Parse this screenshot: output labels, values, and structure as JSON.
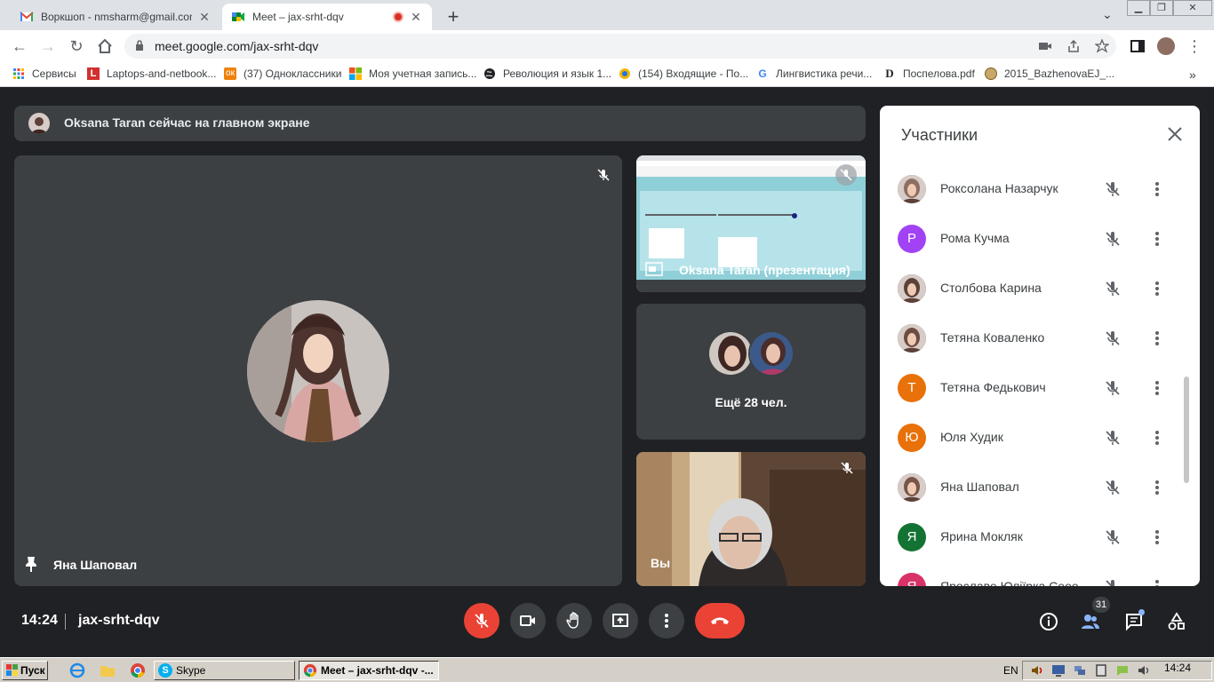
{
  "browser": {
    "tabs": [
      {
        "title": "Воркшоп - nmsharm@gmail.com - G",
        "icon": "gmail-icon"
      },
      {
        "title": "Meet – jax-srht-dqv",
        "icon": "meet-icon",
        "active": true
      }
    ],
    "url": "meet.google.com/jax-srht-dqv",
    "bookmarks": [
      {
        "label": "Сервисы",
        "icon": "apps-grid-icon"
      },
      {
        "label": "Laptops-and-netbook...",
        "icon": "laptops-icon"
      },
      {
        "label": "(37) Одноклассники",
        "icon": "odnoklassniki-icon"
      },
      {
        "label": "Моя учетная запись...",
        "icon": "microsoft-icon"
      },
      {
        "label": "Революция и язык 1...",
        "icon": "globe-icon"
      },
      {
        "label": "(154) Входящие - По...",
        "icon": "mail-icon"
      },
      {
        "label": "Лингвистика речи...",
        "icon": "google-icon"
      },
      {
        "label": "Поспелова.pdf",
        "icon": "pdf-icon"
      },
      {
        "label": "2015_BazhenovaEJ_...",
        "icon": "doc-icon"
      }
    ]
  },
  "meet": {
    "banner": "Oksana Taran сейчас на главном экране",
    "main_name": "Яна Шаповал",
    "presentation_label": "Oksana Taran (презентация)",
    "more_label": "Ещё 28 чел.",
    "self_label": "Вы",
    "time": "14:24",
    "meeting_code": "jax-srht-dqv",
    "participant_count": "31"
  },
  "participants": {
    "title": "Участники",
    "list": [
      {
        "name": "Роксолана Назарчук",
        "avatar": "photo",
        "color": "#8d6e63"
      },
      {
        "name": "Рома Кучма",
        "avatar": "Р",
        "color": "#a142f4"
      },
      {
        "name": "Столбова Карина",
        "avatar": "photo",
        "color": "#5d4037"
      },
      {
        "name": "Тетяна Коваленко",
        "avatar": "photo",
        "color": "#6d4c41"
      },
      {
        "name": "Тетяна Федькович",
        "avatar": "Т",
        "color": "#e8710a"
      },
      {
        "name": "Юля Худик",
        "avatar": "Ю",
        "color": "#e8710a"
      },
      {
        "name": "Яна Шаповал",
        "avatar": "photo",
        "color": "#795548"
      },
      {
        "name": "Ярина Мокляк",
        "avatar": "Я",
        "color": "#137333"
      },
      {
        "name": "Ярославе Юліїрка Сеее",
        "avatar": "Я",
        "color": "#d93268"
      }
    ]
  },
  "taskbar": {
    "start": "Пуск",
    "tasks": [
      "Skype",
      "Meet – jax-srht-dqv -..."
    ],
    "lang": "EN",
    "clock": "14:24"
  }
}
